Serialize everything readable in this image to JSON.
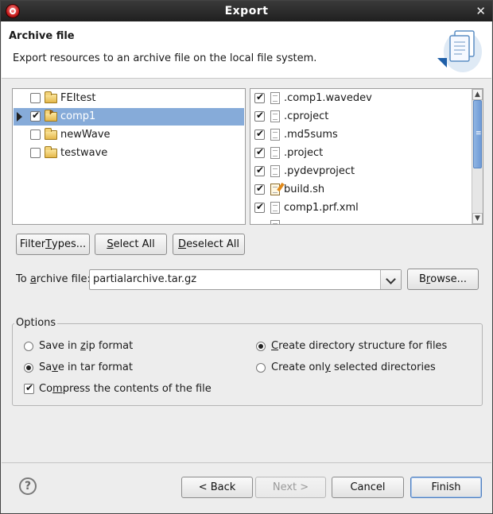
{
  "window": {
    "title": "Export"
  },
  "header": {
    "title": "Archive file",
    "description": "Export resources to an archive file on the local file system."
  },
  "projects": [
    {
      "label": "FEItest",
      "checked": false,
      "selected": false
    },
    {
      "label": "comp1",
      "checked": true,
      "selected": true
    },
    {
      "label": "newWave",
      "checked": false,
      "selected": false
    },
    {
      "label": "testwave",
      "checked": false,
      "selected": false
    }
  ],
  "files": [
    {
      "label": ".comp1.wavedev",
      "checked": true,
      "icon": "file-icon"
    },
    {
      "label": ".cproject",
      "checked": true,
      "icon": "file-icon"
    },
    {
      "label": ".md5sums",
      "checked": true,
      "icon": "file-icon"
    },
    {
      "label": ".project",
      "checked": true,
      "icon": "file-icon"
    },
    {
      "label": ".pydevproject",
      "checked": true,
      "icon": "file-icon"
    },
    {
      "label": "build.sh",
      "checked": true,
      "icon": "script-file-icon"
    },
    {
      "label": "comp1.prf.xml",
      "checked": true,
      "icon": "file-icon"
    }
  ],
  "selection_buttons": {
    "filter_pre": "Filter ",
    "filter_mn": "T",
    "filter_post": "ypes...",
    "select_all_mn": "S",
    "select_all_post": "elect All",
    "deselect_all_mn": "D",
    "deselect_all_post": "eselect All"
  },
  "archive": {
    "label_pre": "To ",
    "label_mn": "a",
    "label_post": "rchive file:",
    "value": "partialarchive.tar.gz",
    "browse_pre": "B",
    "browse_mn": "r",
    "browse_post": "owse..."
  },
  "options": {
    "title": "Options",
    "zip": {
      "pre": "Save in ",
      "mn": "z",
      "post": "ip format",
      "checked": false
    },
    "tar": {
      "pre": "Sa",
      "mn": "v",
      "post": "e in tar format",
      "checked": true
    },
    "compress": {
      "pre": "Co",
      "mn": "m",
      "post": "press the contents of the file",
      "checked": true
    },
    "create_structure": {
      "pre": "",
      "mn": "C",
      "post": "reate directory structure for files",
      "checked": true
    },
    "selected_only": {
      "pre": "Create onl",
      "mn": "y",
      "post": " selected directories",
      "checked": false
    }
  },
  "footer": {
    "back": "< Back",
    "next": "Next >",
    "cancel": "Cancel",
    "finish": "Finish"
  },
  "colors": {
    "selection": "#86abd9",
    "title_bar": "#2b2b2b"
  }
}
